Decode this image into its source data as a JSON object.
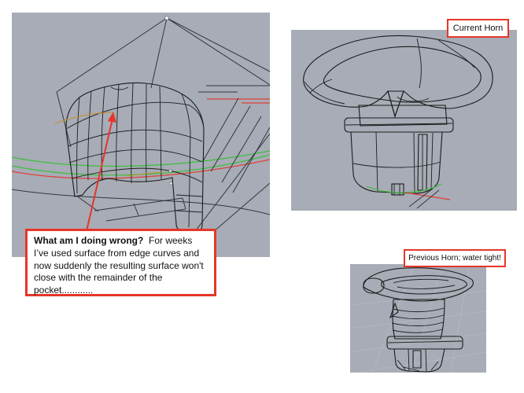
{
  "colors": {
    "viewport_bg": "#a7acb6",
    "annotation_red": "#e53629",
    "curve_green": "#3cbf3c",
    "curve_red": "#e04038",
    "curve_orange": "#c98f2f"
  },
  "annotations": {
    "question_bold": "What am I doing wrong?",
    "question_body": "  For weeks I’ve used surface from edge curves and now suddenly the resulting surface won't close with the remainder of the pocket............",
    "current_horn_label": "Current Horn",
    "previous_horn_label": "Previous Horn; water tight!"
  }
}
